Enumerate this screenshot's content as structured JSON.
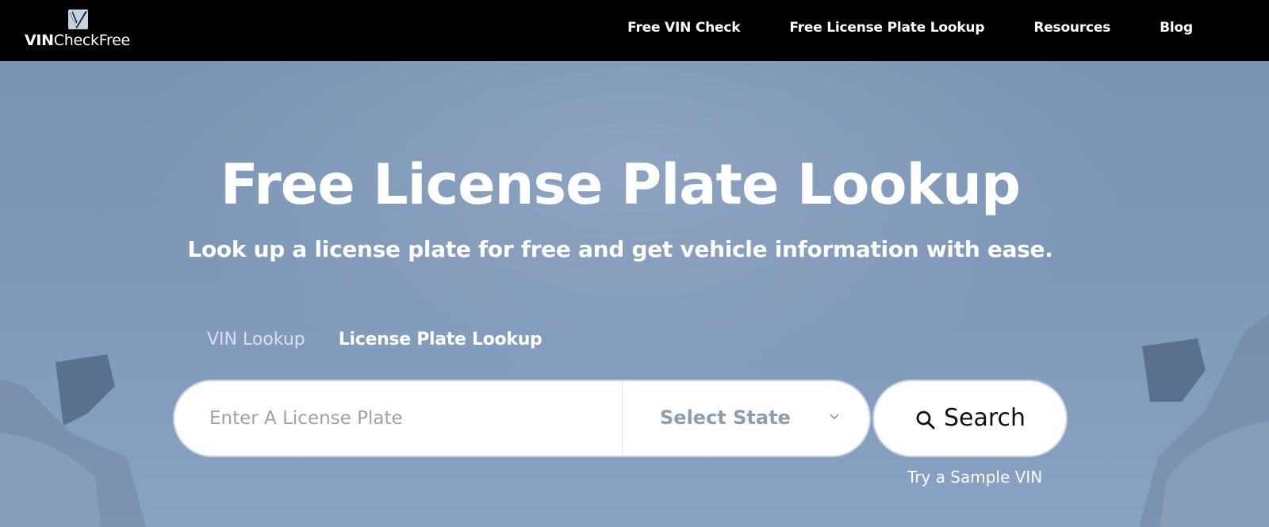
{
  "header": {
    "logo": {
      "bold": "VIN",
      "light": "CheckFree"
    },
    "nav": [
      {
        "label": "Free VIN Check"
      },
      {
        "label": "Free License Plate Lookup"
      },
      {
        "label": "Resources"
      },
      {
        "label": "Blog"
      }
    ]
  },
  "hero": {
    "title": "Free License Plate Lookup",
    "subtitle": "Look up a license plate for free and get vehicle information with ease."
  },
  "tabs": [
    {
      "label": "VIN Lookup",
      "active": false
    },
    {
      "label": "License Plate Lookup",
      "active": true
    }
  ],
  "search": {
    "plate_placeholder": "Enter A License Plate",
    "plate_value": "",
    "state_label": "Select State",
    "button_label": "Search",
    "sample_link": "Try a Sample VIN"
  },
  "colors": {
    "header_bg": "#000000",
    "hero_bg": "#7f9bba",
    "state_text": "#8c9db3"
  },
  "icons": [
    "checkmark-logo-icon",
    "chevron-down-icon",
    "search-icon"
  ]
}
